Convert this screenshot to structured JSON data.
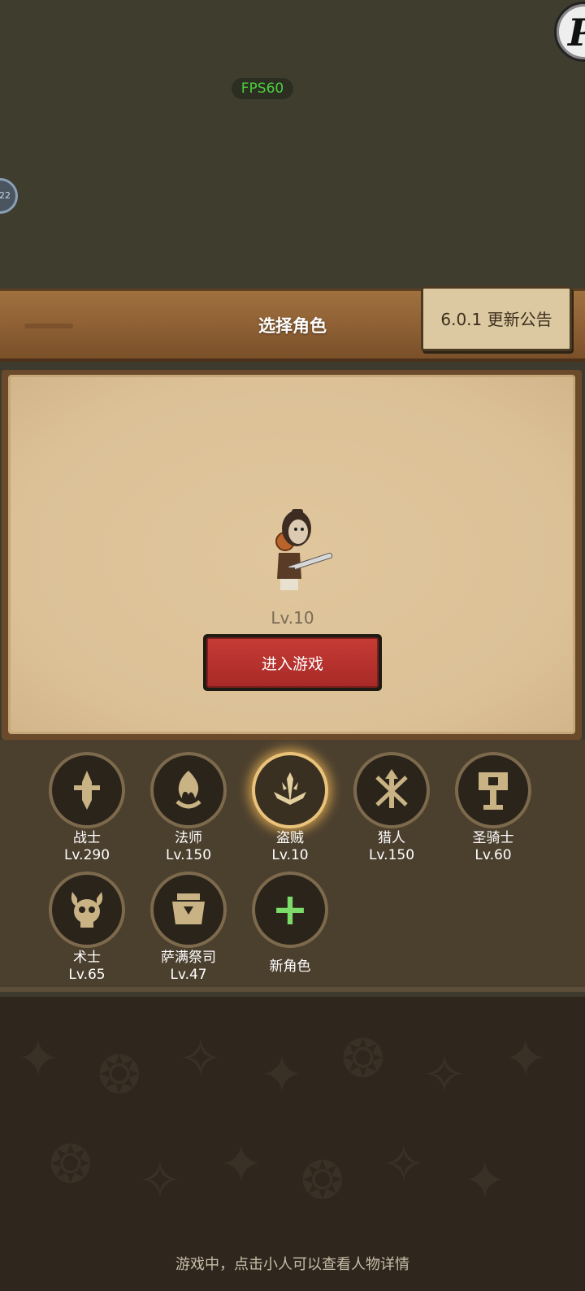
{
  "overlay": {
    "fps": "FPS60",
    "corner_letter": "P",
    "side_badge": "22"
  },
  "header": {
    "title": "选择角色",
    "notice_button": "6.0.1 更新公告"
  },
  "character": {
    "level": "Lv.10",
    "enter_button": "进入游戏"
  },
  "classes": [
    {
      "name": "战士",
      "level": "Lv.290",
      "icon": "warrior-sword-icon"
    },
    {
      "name": "法师",
      "level": "Lv.150",
      "icon": "mage-flame-icon"
    },
    {
      "name": "盗贼",
      "level": "Lv.10",
      "icon": "rogue-daggers-icon",
      "selected": true
    },
    {
      "name": "猎人",
      "level": "Lv.150",
      "icon": "hunter-arrows-icon"
    },
    {
      "name": "圣骑士",
      "level": "Lv.60",
      "icon": "paladin-hammer-icon"
    },
    {
      "name": "术士",
      "level": "Lv.65",
      "icon": "warlock-skull-icon"
    },
    {
      "name": "萨满祭司",
      "level": "Lv.47",
      "icon": "shaman-totem-icon"
    }
  ],
  "new_character": {
    "label": "新角色",
    "icon": "plus-icon"
  },
  "footer": {
    "tip": "游戏中，点击小人可以查看人物详情"
  },
  "colors": {
    "accent_gold": "#e9c37a",
    "button_red": "#c63b35",
    "plus_green": "#7ddb6a",
    "fps_green": "#4ccf3e"
  }
}
